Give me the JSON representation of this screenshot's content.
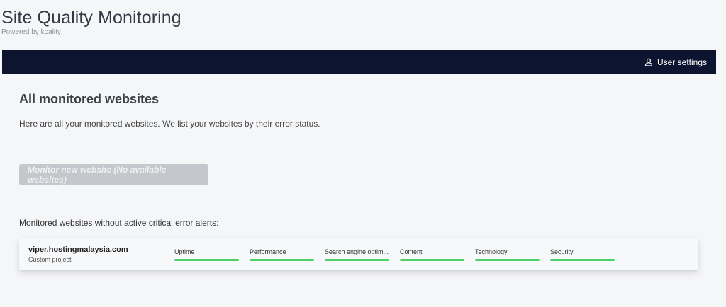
{
  "brand": {
    "title": "Site Quality Monitoring",
    "subtitle": "Powered by koality"
  },
  "topbar": {
    "user_settings_label": "User settings",
    "user_icon": "user-icon",
    "background_color": "#0c1430"
  },
  "main": {
    "title": "All monitored websites",
    "description": "Here are all your monitored websites. We list your websites by their error status.",
    "monitor_button_label": "Monitor new website (No available websites)",
    "section_label": "Monitored websites without active critical error alerts:"
  },
  "websites": [
    {
      "name": "viper.hostingmalaysia.com",
      "type": "Custom project",
      "categories": [
        {
          "label": "Uptime",
          "status_color": "#4cd16a"
        },
        {
          "label": "Performance",
          "status_color": "#4cd16a"
        },
        {
          "label": "Search engine optim...",
          "status_color": "#4cd16a"
        },
        {
          "label": "Content",
          "status_color": "#4cd16a"
        },
        {
          "label": "Technology",
          "status_color": "#4cd16a"
        },
        {
          "label": "Security",
          "status_color": "#4cd16a"
        }
      ]
    }
  ]
}
